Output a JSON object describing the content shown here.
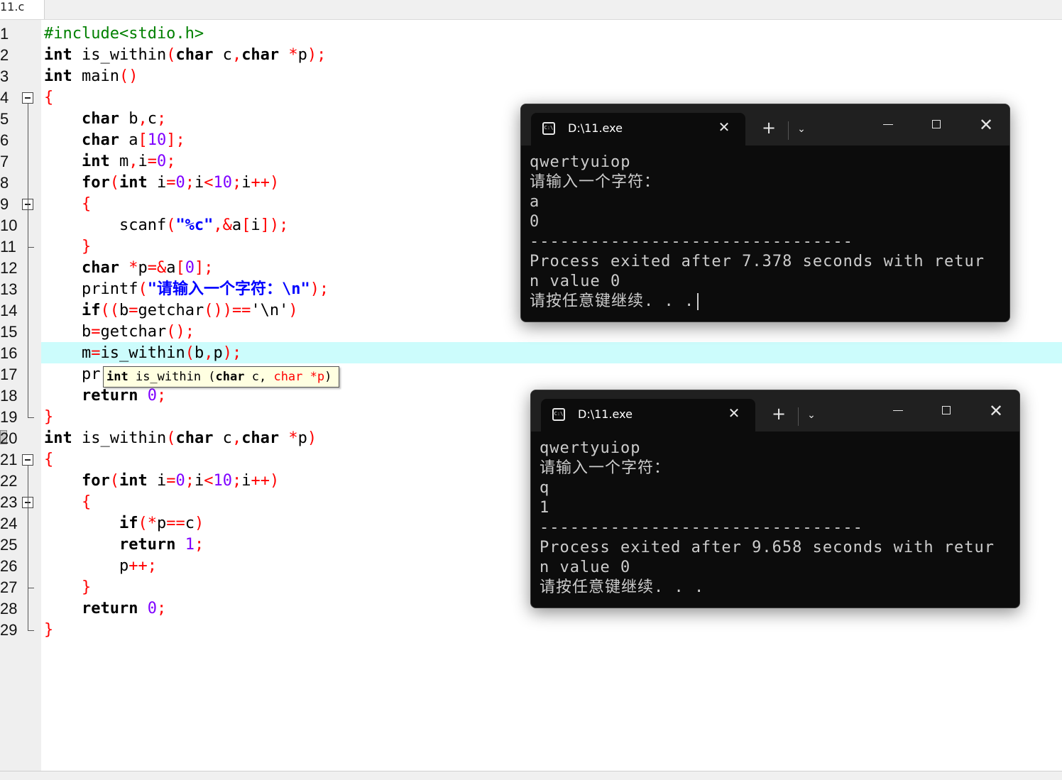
{
  "editor": {
    "tab_label": "11.c",
    "line_numbers": [
      "1",
      "2",
      "3",
      "4",
      "5",
      "6",
      "7",
      "8",
      "9",
      "10",
      "11",
      "12",
      "13",
      "14",
      "15",
      "16",
      "17",
      "18",
      "19",
      "20",
      "21",
      "22",
      "23",
      "24",
      "25",
      "26",
      "27",
      "28",
      "29"
    ],
    "lines": [
      [
        {
          "t": "#include<stdio.h>",
          "c": "pp"
        }
      ],
      [
        {
          "t": "int",
          "c": "kw"
        },
        {
          "t": " is_within"
        },
        {
          "t": "(",
          "c": "op"
        },
        {
          "t": "char",
          "c": "kw"
        },
        {
          "t": " c"
        },
        {
          "t": ",",
          "c": "op"
        },
        {
          "t": "char",
          "c": "kw"
        },
        {
          "t": " "
        },
        {
          "t": "*",
          "c": "op"
        },
        {
          "t": "p"
        },
        {
          "t": ");",
          "c": "op"
        }
      ],
      [
        {
          "t": "int",
          "c": "kw"
        },
        {
          "t": " main"
        },
        {
          "t": "()",
          "c": "op"
        }
      ],
      [
        {
          "t": "{",
          "c": "op"
        }
      ],
      [
        {
          "t": "    "
        },
        {
          "t": "char",
          "c": "kw"
        },
        {
          "t": " b"
        },
        {
          "t": ",",
          "c": "op"
        },
        {
          "t": "c"
        },
        {
          "t": ";",
          "c": "op"
        }
      ],
      [
        {
          "t": "    "
        },
        {
          "t": "char",
          "c": "kw"
        },
        {
          "t": " a"
        },
        {
          "t": "[",
          "c": "op"
        },
        {
          "t": "10",
          "c": "num"
        },
        {
          "t": "];",
          "c": "op"
        }
      ],
      [
        {
          "t": "    "
        },
        {
          "t": "int",
          "c": "kw"
        },
        {
          "t": " m"
        },
        {
          "t": ",",
          "c": "op"
        },
        {
          "t": "i"
        },
        {
          "t": "=",
          "c": "op"
        },
        {
          "t": "0",
          "c": "num"
        },
        {
          "t": ";",
          "c": "op"
        }
      ],
      [
        {
          "t": "    "
        },
        {
          "t": "for",
          "c": "kw"
        },
        {
          "t": "(",
          "c": "op"
        },
        {
          "t": "int",
          "c": "kw"
        },
        {
          "t": " i"
        },
        {
          "t": "=",
          "c": "op"
        },
        {
          "t": "0",
          "c": "num"
        },
        {
          "t": ";",
          "c": "op"
        },
        {
          "t": "i"
        },
        {
          "t": "<",
          "c": "op"
        },
        {
          "t": "10",
          "c": "num"
        },
        {
          "t": ";",
          "c": "op"
        },
        {
          "t": "i"
        },
        {
          "t": "++)",
          "c": "op"
        }
      ],
      [
        {
          "t": "    "
        },
        {
          "t": "{",
          "c": "op"
        }
      ],
      [
        {
          "t": "        scanf"
        },
        {
          "t": "(",
          "c": "op"
        },
        {
          "t": "\"%c\"",
          "c": "str"
        },
        {
          "t": ",&",
          "c": "op"
        },
        {
          "t": "a"
        },
        {
          "t": "[",
          "c": "op"
        },
        {
          "t": "i"
        },
        {
          "t": "]);",
          "c": "op"
        }
      ],
      [
        {
          "t": "    "
        },
        {
          "t": "}",
          "c": "op"
        }
      ],
      [
        {
          "t": "    "
        },
        {
          "t": "char",
          "c": "kw"
        },
        {
          "t": " "
        },
        {
          "t": "*",
          "c": "op"
        },
        {
          "t": "p"
        },
        {
          "t": "=&",
          "c": "op"
        },
        {
          "t": "a"
        },
        {
          "t": "[",
          "c": "op"
        },
        {
          "t": "0",
          "c": "num"
        },
        {
          "t": "];",
          "c": "op"
        }
      ],
      [
        {
          "t": "    printf"
        },
        {
          "t": "(",
          "c": "op"
        },
        {
          "t": "\"请输入一个字符：\\n\"",
          "c": "str"
        },
        {
          "t": ");",
          "c": "op"
        }
      ],
      [
        {
          "t": "    "
        },
        {
          "t": "if",
          "c": "kw"
        },
        {
          "t": "((",
          "c": "op"
        },
        {
          "t": "b"
        },
        {
          "t": "=",
          "c": "op"
        },
        {
          "t": "getchar"
        },
        {
          "t": "())==",
          "c": "op"
        },
        {
          "t": "'\\n'"
        },
        {
          "t": ")",
          "c": "op"
        }
      ],
      [
        {
          "t": "    b"
        },
        {
          "t": "=",
          "c": "op"
        },
        {
          "t": "getchar"
        },
        {
          "t": "();",
          "c": "op"
        }
      ],
      [
        {
          "t": "    m"
        },
        {
          "t": "=",
          "c": "op"
        },
        {
          "t": "is_within"
        },
        {
          "t": "(",
          "c": "op"
        },
        {
          "t": "b"
        },
        {
          "t": ",",
          "c": "op"
        },
        {
          "t": "p"
        },
        {
          "t": ");",
          "c": "op"
        }
      ],
      [
        {
          "t": "    pr"
        }
      ],
      [
        {
          "t": "    "
        },
        {
          "t": "return",
          "c": "kw"
        },
        {
          "t": " "
        },
        {
          "t": "0",
          "c": "num"
        },
        {
          "t": ";",
          "c": "op"
        }
      ],
      [
        {
          "t": "}",
          "c": "op"
        }
      ],
      [
        {
          "t": "int",
          "c": "kw"
        },
        {
          "t": " is_within"
        },
        {
          "t": "(",
          "c": "op"
        },
        {
          "t": "char",
          "c": "kw"
        },
        {
          "t": " c"
        },
        {
          "t": ",",
          "c": "op"
        },
        {
          "t": "char",
          "c": "kw"
        },
        {
          "t": " "
        },
        {
          "t": "*",
          "c": "op"
        },
        {
          "t": "p"
        },
        {
          "t": ")",
          "c": "op"
        }
      ],
      [
        {
          "t": "{",
          "c": "op"
        }
      ],
      [
        {
          "t": "    "
        },
        {
          "t": "for",
          "c": "kw"
        },
        {
          "t": "(",
          "c": "op"
        },
        {
          "t": "int",
          "c": "kw"
        },
        {
          "t": " i"
        },
        {
          "t": "=",
          "c": "op"
        },
        {
          "t": "0",
          "c": "num"
        },
        {
          "t": ";",
          "c": "op"
        },
        {
          "t": "i"
        },
        {
          "t": "<",
          "c": "op"
        },
        {
          "t": "10",
          "c": "num"
        },
        {
          "t": ";",
          "c": "op"
        },
        {
          "t": "i"
        },
        {
          "t": "++)",
          "c": "op"
        }
      ],
      [
        {
          "t": "    "
        },
        {
          "t": "{",
          "c": "op"
        }
      ],
      [
        {
          "t": "        "
        },
        {
          "t": "if",
          "c": "kw"
        },
        {
          "t": "(*",
          "c": "op"
        },
        {
          "t": "p"
        },
        {
          "t": "==",
          "c": "op"
        },
        {
          "t": "c"
        },
        {
          "t": ")",
          "c": "op"
        }
      ],
      [
        {
          "t": "        "
        },
        {
          "t": "return",
          "c": "kw"
        },
        {
          "t": " "
        },
        {
          "t": "1",
          "c": "num"
        },
        {
          "t": ";",
          "c": "op"
        }
      ],
      [
        {
          "t": "        p"
        },
        {
          "t": "++;",
          "c": "op"
        }
      ],
      [
        {
          "t": "    "
        },
        {
          "t": "}",
          "c": "op"
        }
      ],
      [
        {
          "t": "    "
        },
        {
          "t": "return",
          "c": "kw"
        },
        {
          "t": " "
        },
        {
          "t": "0",
          "c": "num"
        },
        {
          "t": ";",
          "c": "op"
        }
      ],
      [
        {
          "t": "}",
          "c": "op"
        }
      ]
    ],
    "highlighted_line": "16",
    "tooltip": {
      "segments": [
        {
          "t": "int",
          "c": "kw"
        },
        {
          "t": " is_within ("
        },
        {
          "t": "char",
          "c": "kw"
        },
        {
          "t": " c, "
        },
        {
          "t": "char",
          "c": "op"
        },
        {
          "t": " "
        },
        {
          "t": "*p",
          "c": "op"
        },
        {
          "t": ")"
        }
      ]
    }
  },
  "terminals": [
    {
      "tab_title": "D:\\11.exe",
      "icon": "cmd-icon",
      "output_lines": [
        "qwertyuiop",
        "请输入一个字符：",
        "a",
        "0",
        "--------------------------------",
        "Process exited after 7.378 seconds with retur",
        "n value 0",
        "请按任意键继续. . ."
      ],
      "has_cursor": true
    },
    {
      "tab_title": "D:\\11.exe",
      "icon": "cmd-icon",
      "output_lines": [
        "qwertyuiop",
        "请输入一个字符：",
        "q",
        "1",
        "--------------------------------",
        "Process exited after 9.658 seconds with retur",
        "n value 0",
        "请按任意键继续. . ."
      ],
      "has_cursor": false
    }
  ],
  "window_controls": {
    "close_tab": "✕",
    "new_tab": "+",
    "dropdown": "⌄",
    "close": "✕",
    "cmd_glyph": "C:\\"
  }
}
